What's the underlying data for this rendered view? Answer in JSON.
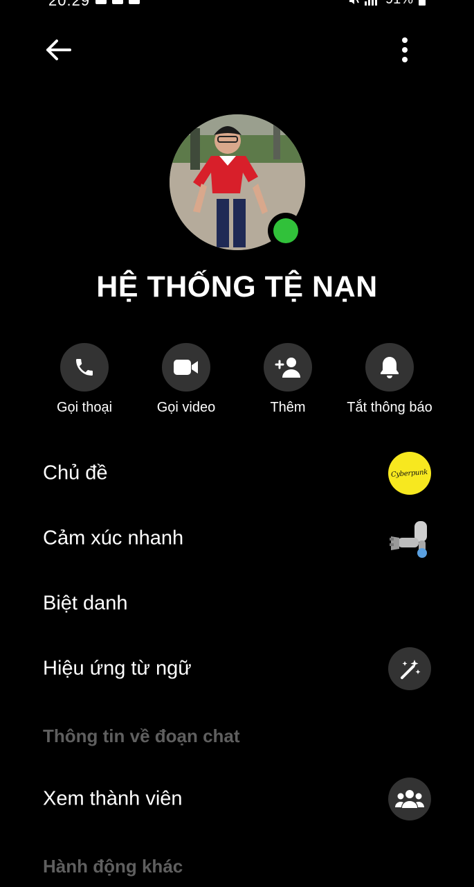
{
  "status_bar": {
    "time": "20:29",
    "battery": "91%"
  },
  "profile": {
    "name": "HỆ THỐNG TỆ NẠN",
    "online": true,
    "online_color": "#31c13a"
  },
  "actions": [
    {
      "label": "Gọi thoại",
      "icon": "phone-icon"
    },
    {
      "label": "Gọi video",
      "icon": "video-camera-icon"
    },
    {
      "label": "Thêm",
      "icon": "add-person-icon"
    },
    {
      "label": "Tắt thông báo",
      "icon": "bell-icon"
    }
  ],
  "settings": {
    "theme": {
      "label": "Chủ đề",
      "badge_text": "Cyberpunk",
      "badge_color": "#f7e81f"
    },
    "quick_reaction": {
      "label": "Cảm xúc nhanh",
      "icon": "robot-arm-icon"
    },
    "nicknames": {
      "label": "Biệt danh"
    },
    "word_effects": {
      "label": "Hiệu ứng từ ngữ",
      "icon": "magic-wand-icon"
    }
  },
  "sections": {
    "chat_info": "Thông tin về đoạn chat",
    "other_actions": "Hành động khác"
  },
  "chat_info": {
    "view_members": {
      "label": "Xem thành viên",
      "icon": "people-icon"
    }
  },
  "colors": {
    "background": "#000000",
    "button_bg": "#333333",
    "section_heading": "#5f5f5f",
    "text": "#ffffff"
  }
}
